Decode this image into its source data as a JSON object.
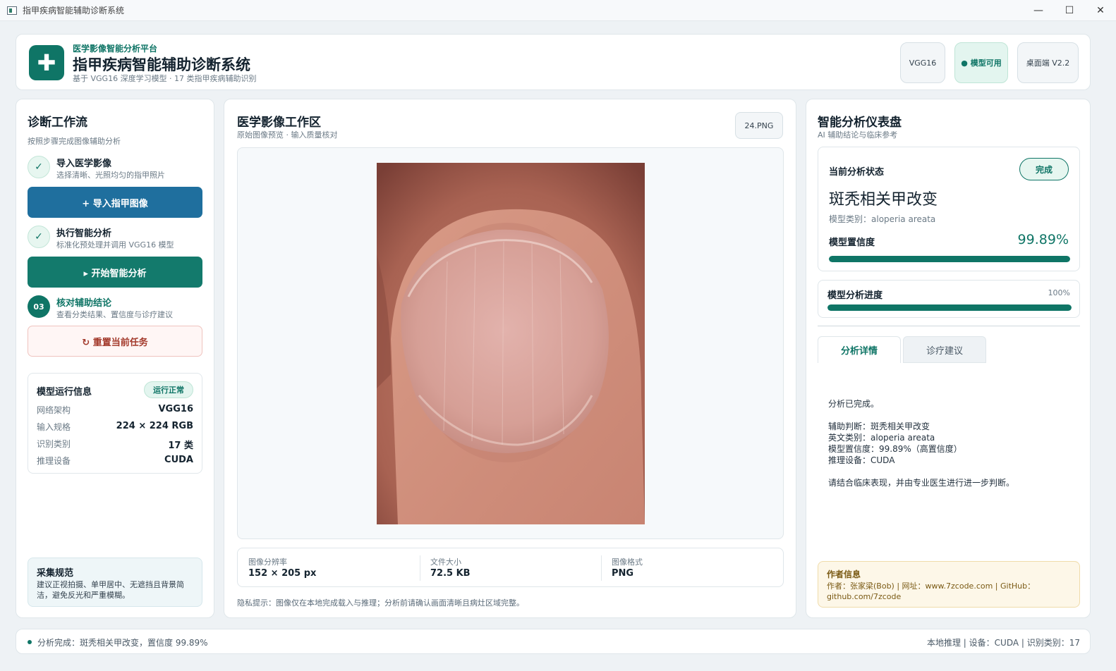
{
  "window": {
    "title": "指甲疾病智能辅助诊断系统",
    "controls": {
      "minimize": "—",
      "maximize": "☐",
      "close": "✕"
    }
  },
  "header": {
    "logo_icon": "plus-cross-icon",
    "logo_glyph": "✚",
    "kicker": "医学影像智能分析平台",
    "title": "指甲疾病智能辅助诊断系统",
    "subtitle": "基于 VGG16 深度学习模型 · 17 类指甲疾病辅助识别",
    "pills": {
      "model": "VGG16",
      "status": "● 模型可用",
      "version": "桌面端 V2.2"
    }
  },
  "workflow": {
    "title": "诊断工作流",
    "subtitle": "按照步骤完成图像辅助分析",
    "steps": [
      {
        "marker": "✓",
        "title": "导入医学影像",
        "desc": "选择清晰、光照均匀的指甲照片"
      },
      {
        "marker": "✓",
        "title": "执行智能分析",
        "desc": "标准化预处理并调用 VGG16 模型"
      },
      {
        "marker": "03",
        "title": "核对辅助结论",
        "desc": "查看分类结果、置信度与诊疗建议"
      }
    ],
    "buttons": {
      "import": "+ 导入指甲图像",
      "analyze": "▸ 开始智能分析",
      "reset": "↻ 重置当前任务"
    },
    "model_info": {
      "title": "模型运行信息",
      "badge": "运行正常",
      "rows": [
        {
          "k": "网络架构",
          "v": "VGG16"
        },
        {
          "k": "输入规格",
          "v": "224 × 224 RGB"
        },
        {
          "k": "识别类别",
          "v": "17 类"
        },
        {
          "k": "推理设备",
          "v": "CUDA"
        }
      ]
    },
    "guide": {
      "title": "采集规范",
      "text": "建议正视拍摄、单甲居中、无遮挡且背景简洁，避免反光和严重模糊。"
    }
  },
  "workspace": {
    "title": "医学影像工作区",
    "subtitle": "原始图像预览 · 输入质量核对",
    "file_name": "24.PNG",
    "meta": [
      {
        "k": "图像分辨率",
        "v": "152 × 205 px"
      },
      {
        "k": "文件大小",
        "v": "72.5 KB"
      },
      {
        "k": "图像格式",
        "v": "PNG"
      }
    ],
    "privacy": "隐私提示：图像仅在本地完成载入与推理；分析前请确认画面清晰且病灶区域完整。"
  },
  "dashboard": {
    "title": "智能分析仪表盘",
    "subtitle": "AI 辅助结论与临床参考",
    "status_label": "当前分析状态",
    "status_pill": "完成",
    "diagnosis": "斑秃相关甲改变",
    "model_class": "模型类别：aloperia areata",
    "confidence_label": "模型置信度",
    "confidence_text": "99.89%",
    "confidence_value": 0.9989,
    "progress_label": "模型分析进度",
    "progress_text": "100%",
    "progress_value": 1.0,
    "tabs": [
      "分析详情",
      "诊疗建议"
    ],
    "detail_lines": [
      "分析已完成。",
      "",
      "辅助判断：斑秃相关甲改变",
      "英文类别：aloperia areata",
      "模型置信度：99.89%（高置信度）",
      "推理设备：CUDA",
      "",
      "请结合临床表现，并由专业医生进行进一步判断。"
    ],
    "author": {
      "title": "作者信息",
      "text": "作者：张家梁(Bob) | 网址：www.7zcode.com | GitHub：github.com/7zcode"
    }
  },
  "footer": {
    "left": "分析完成：斑秃相关甲改变，置信度 99.89%",
    "right": "本地推理 | 设备：CUDA | 识别类别：17"
  },
  "colors": {
    "accent": "#0f7566",
    "primary_blue": "#1f6f9e",
    "reset_red": "#a33a2c"
  }
}
